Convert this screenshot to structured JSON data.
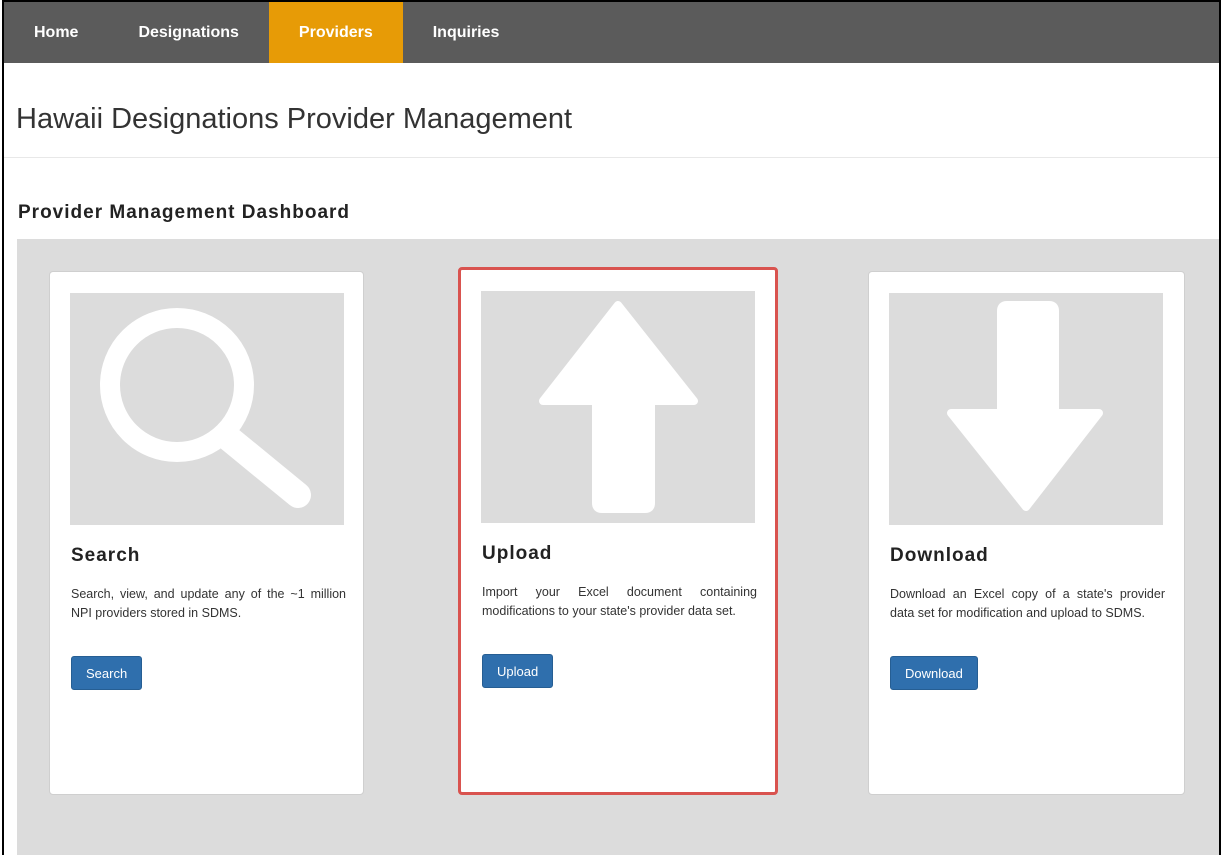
{
  "nav": {
    "items": [
      {
        "label": "Home",
        "active": false
      },
      {
        "label": "Designations",
        "active": false
      },
      {
        "label": "Providers",
        "active": true
      },
      {
        "label": "Inquiries",
        "active": false
      }
    ]
  },
  "page_title": "Hawaii Designations Provider Management",
  "dashboard": {
    "title": "Provider Management Dashboard",
    "cards": [
      {
        "icon": "magnifying-glass-icon",
        "title": "Search",
        "description": "Search, view, and update any of the ~1 million NPI providers stored in SDMS.",
        "button": "Search"
      },
      {
        "icon": "upload-arrow-icon",
        "title": "Upload",
        "description": "Import your Excel document containing modifications to your state's provider data set.",
        "button": "Upload"
      },
      {
        "icon": "download-arrow-icon",
        "title": "Download",
        "description": "Download an Excel copy of a state's provider data set for modification and upload to SDMS.",
        "button": "Download"
      }
    ]
  },
  "colors": {
    "navbar": "#5b5b5b",
    "active_tab": "#e79b06",
    "button": "#2f6fad",
    "highlight_border": "#d9534f",
    "panel": "#dcdcdc"
  }
}
